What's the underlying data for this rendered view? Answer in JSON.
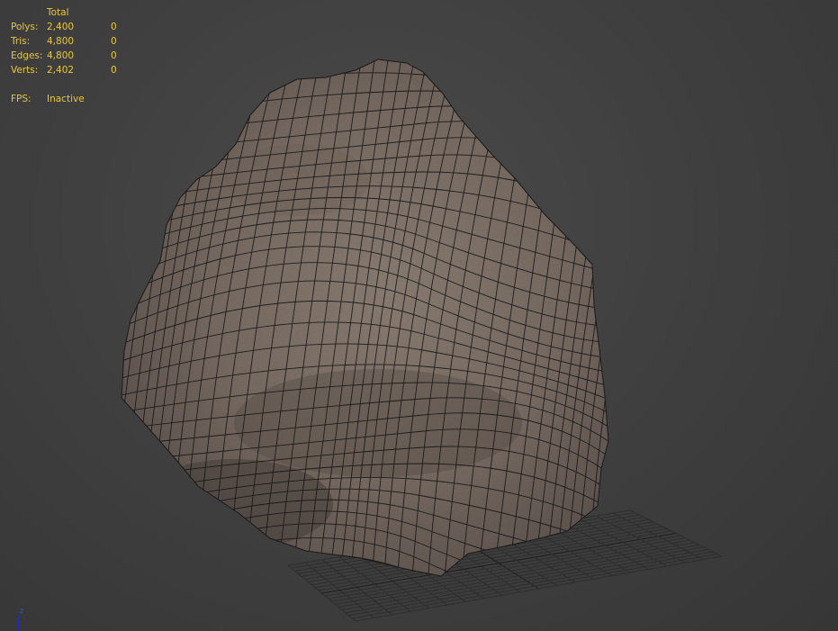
{
  "stats": {
    "header": "Total",
    "rows": [
      {
        "label": "Polys:",
        "total": "2,400",
        "selected": "0"
      },
      {
        "label": "Tris:",
        "total": "4,800",
        "selected": "0"
      },
      {
        "label": "Edges:",
        "total": "4,800",
        "selected": "0"
      },
      {
        "label": "Verts:",
        "total": "2,402",
        "selected": "0"
      }
    ],
    "fps_label": "FPS:",
    "fps_value": "Inactive"
  },
  "axis": {
    "z_label": "z"
  },
  "colors": {
    "stats_text": "#e6c93a",
    "grid": "#2a2a2a",
    "rock": "#807168",
    "wire": "#141414",
    "axis_z": "#1a2cc4"
  }
}
